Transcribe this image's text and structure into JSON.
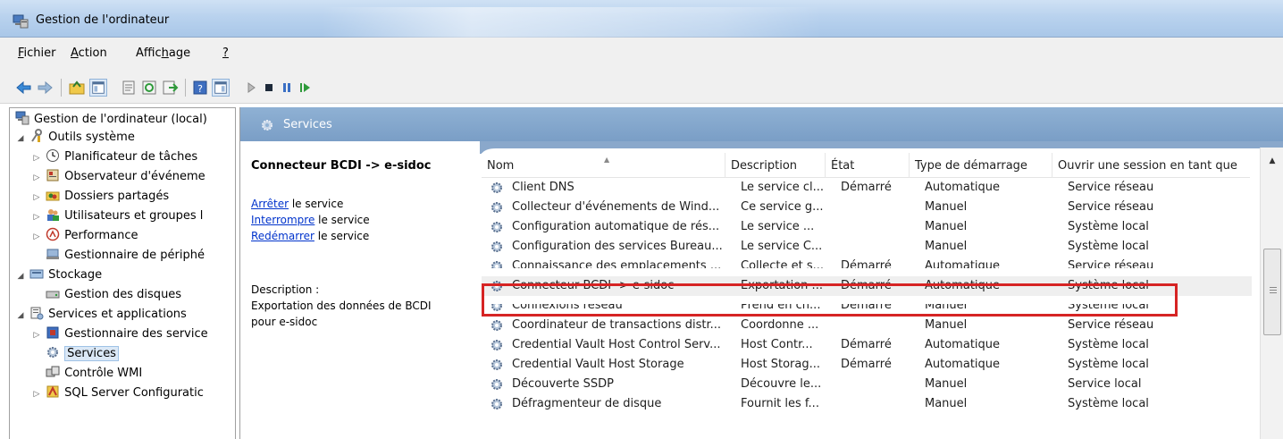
{
  "window": {
    "title": "Gestion de l'ordinateur"
  },
  "menu": {
    "items": [
      {
        "pre": "",
        "ul": "F",
        "post": "ichier"
      },
      {
        "pre": "",
        "ul": "A",
        "post": "ction"
      },
      {
        "pre": "Affic",
        "ul": "h",
        "post": "age"
      },
      {
        "pre": "",
        "ul": "?",
        "post": ""
      }
    ]
  },
  "toolbar": {
    "icons": [
      "back-arrow-icon",
      "forward-arrow-icon",
      "up-folder-icon",
      "show-hide-tree-icon",
      "properties-icon",
      "refresh-icon",
      "export-list-icon",
      "help-icon",
      "show-hide-action-pane-icon",
      "start-service-icon",
      "stop-service-icon",
      "pause-service-icon",
      "resume-service-icon"
    ]
  },
  "tree": {
    "items": [
      {
        "label": "Gestion de l'ordinateur (local)",
        "indent": 0,
        "twisty": "",
        "icon": "computer-management-icon"
      },
      {
        "label": "Outils système",
        "indent": 1,
        "twisty": "◢",
        "icon": "system-tools-icon"
      },
      {
        "label": "Planificateur de tâches",
        "indent": 2,
        "twisty": "▷",
        "icon": "task-scheduler-icon"
      },
      {
        "label": "Observateur d'événeme",
        "indent": 2,
        "twisty": "▷",
        "icon": "event-viewer-icon"
      },
      {
        "label": "Dossiers partagés",
        "indent": 2,
        "twisty": "▷",
        "icon": "shared-folders-icon"
      },
      {
        "label": "Utilisateurs et groupes l",
        "indent": 2,
        "twisty": "▷",
        "icon": "users-groups-icon"
      },
      {
        "label": "Performance",
        "indent": 2,
        "twisty": "▷",
        "icon": "performance-icon"
      },
      {
        "label": "Gestionnaire de périphé",
        "indent": 2,
        "twisty": "",
        "icon": "device-manager-icon"
      },
      {
        "label": "Stockage",
        "indent": 1,
        "twisty": "◢",
        "icon": "storage-icon"
      },
      {
        "label": "Gestion des disques",
        "indent": 2,
        "twisty": "",
        "icon": "disk-management-icon"
      },
      {
        "label": "Services et applications",
        "indent": 1,
        "twisty": "◢",
        "icon": "services-apps-icon"
      },
      {
        "label": "Gestionnaire des service",
        "indent": 2,
        "twisty": "▷",
        "icon": "sql-service-manager-icon"
      },
      {
        "label": "Services",
        "indent": 2,
        "twisty": "",
        "icon": "services-icon",
        "selected": true
      },
      {
        "label": "Contrôle WMI",
        "indent": 2,
        "twisty": "",
        "icon": "wmi-control-icon"
      },
      {
        "label": "SQL Server Configuratic",
        "indent": 2,
        "twisty": "▷",
        "icon": "sql-config-icon"
      }
    ]
  },
  "services_header": {
    "title": "Services"
  },
  "detail": {
    "service_name": "Connecteur BCDI -> e-sidoc",
    "actions": [
      {
        "link": "Arrêter",
        "rest": " le service"
      },
      {
        "link": "Interrompre",
        "rest": " le service"
      },
      {
        "link": "Redémarrer",
        "rest": " le service"
      }
    ],
    "description_label": "Description :",
    "description_lines": [
      "Exportation des données de BCDI",
      "pour e-sidoc"
    ]
  },
  "columns": [
    "Nom",
    "Description",
    "État",
    "Type de démarrage",
    "Ouvrir une session en tant que"
  ],
  "rows": [
    {
      "name": "Client DNS",
      "desc": "Le service cl...",
      "state": "Démarré",
      "start": "Automatique",
      "logon": "Service réseau"
    },
    {
      "name": "Collecteur d'événements de Wind...",
      "desc": "Ce service g...",
      "state": "",
      "start": "Manuel",
      "logon": "Service réseau"
    },
    {
      "name": "Configuration automatique de rés...",
      "desc": "Le service ...",
      "state": "",
      "start": "Manuel",
      "logon": "Système local"
    },
    {
      "name": "Configuration des services Bureau...",
      "desc": "Le service C...",
      "state": "",
      "start": "Manuel",
      "logon": "Système local"
    },
    {
      "name": "Connaissance des emplacements ...",
      "desc": "Collecte et s...",
      "state": "Démarré",
      "start": "Automatique",
      "logon": "Service réseau",
      "cut": true
    },
    {
      "name": "Connecteur BCDI -> e-sidoc",
      "desc": "Exportation ...",
      "state": "Démarré",
      "start": "Automatique",
      "logon": "Système local",
      "highlight": true
    },
    {
      "name": "Connexions réseau",
      "desc": "Prend en ch...",
      "state": "Démarré",
      "start": "Manuel",
      "logon": "Système local",
      "cutTop": true
    },
    {
      "name": "Coordinateur de transactions distr...",
      "desc": "Coordonne ...",
      "state": "",
      "start": "Manuel",
      "logon": "Service réseau"
    },
    {
      "name": "Credential Vault Host Control Serv...",
      "desc": "Host Contr...",
      "state": "Démarré",
      "start": "Automatique",
      "logon": "Système local"
    },
    {
      "name": "Credential Vault Host Storage",
      "desc": "Host Storag...",
      "state": "Démarré",
      "start": "Automatique",
      "logon": "Système local"
    },
    {
      "name": "Découverte SSDP",
      "desc": "Découvre le...",
      "state": "",
      "start": "Manuel",
      "logon": "Service local"
    },
    {
      "name": "Défragmenteur de disque",
      "desc": "Fournit les f...",
      "state": "",
      "start": "Manuel",
      "logon": "Système local"
    }
  ]
}
